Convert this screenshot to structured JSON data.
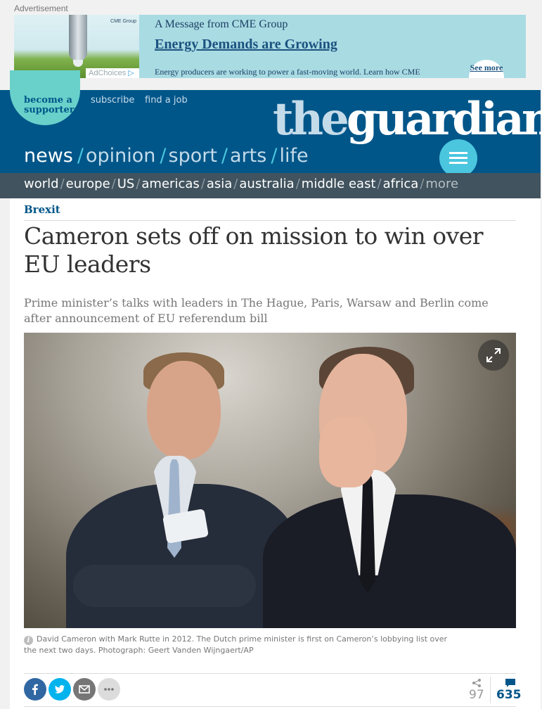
{
  "ad": {
    "label": "Advertisement",
    "brand": "CME Group",
    "subtitle": "A Message from CME Group",
    "headline": "Energy Demands are Growing",
    "body": "Energy producers are working to power a fast-moving world. Learn how CME",
    "cta": "See more",
    "adchoices": "AdChoices"
  },
  "header": {
    "supporter": "become a supporter",
    "links": [
      "subscribe",
      "find a job"
    ],
    "logo_the": "the",
    "logo_guardian": "guardian",
    "pillars": [
      "news",
      "opinion",
      "sport",
      "arts",
      "life"
    ],
    "active_pillar": "news"
  },
  "subnav": {
    "items": [
      "world",
      "europe",
      "US",
      "americas",
      "asia",
      "australia",
      "middle east",
      "africa"
    ],
    "more": "more"
  },
  "article": {
    "kicker": "Brexit",
    "headline": "Cameron sets off on mission to win over EU leaders",
    "standfirst": "Prime minister’s talks with leaders in The Hague, Paris, Warsaw and Berlin come after announcement of EU referendum bill",
    "caption": "David Cameron with Mark Rutte in 2012. The Dutch prime minister is first on Cameron’s lobbying list over the next two days. Photograph: Geert Vanden Wijngaert/AP"
  },
  "social": {
    "buttons": [
      {
        "icon": "facebook-icon",
        "color": "#3067a3"
      },
      {
        "icon": "twitter-icon",
        "color": "#03b3ee"
      },
      {
        "icon": "email-icon",
        "color": "#767676"
      },
      {
        "icon": "more-icon",
        "color": "#dcdcdc"
      }
    ],
    "share_count": "97",
    "comment_count": "635"
  },
  "colors": {
    "brand_blue": "#005689",
    "accent": "#4bc6df",
    "supporter": "#69d1ca",
    "subnav": "#41535e"
  }
}
